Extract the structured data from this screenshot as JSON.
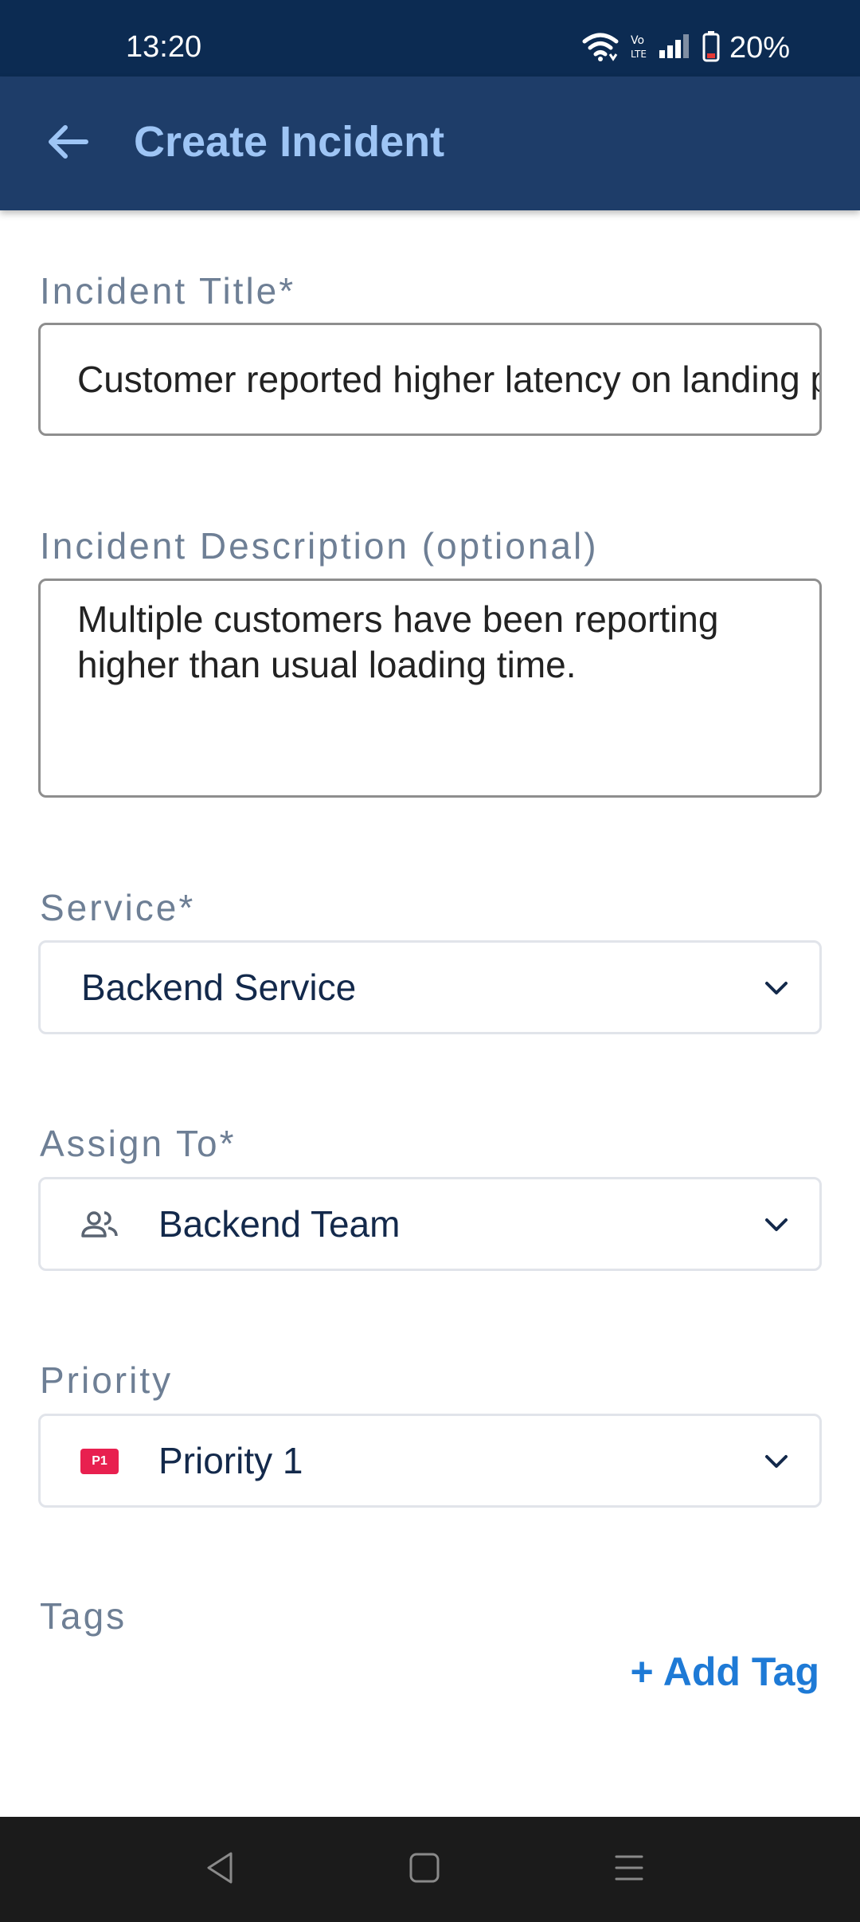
{
  "status_bar": {
    "time": "13:20",
    "battery": "20%",
    "icons": [
      "wifi-icon",
      "volte-icon",
      "signal-icon",
      "battery-icon"
    ]
  },
  "app_bar": {
    "back_icon": "arrow-left-icon",
    "title": "Create Incident"
  },
  "form": {
    "title_label": "Incident Title*",
    "title_value": "Customer reported higher latency on landing page",
    "description_label": "Incident Description (optional)",
    "description_value": "Multiple customers have been reporting higher than usual loading time.",
    "service_label": "Service*",
    "service_value": "Backend Service",
    "assign_label": "Assign To*",
    "assign_value": "Backend Team",
    "assign_icon": "people-icon",
    "priority_label": "Priority",
    "priority_badge": "P1",
    "priority_value": "Priority 1",
    "tags_label": "Tags",
    "add_tag_label": "+ Add Tag"
  },
  "nav_bar": {
    "icons": [
      "back-triangle-icon",
      "home-square-icon",
      "menu-lines-icon"
    ]
  },
  "colors": {
    "status_bar": "#0c2b52",
    "app_bar": "#1e3d69",
    "title_text": "#9ec5f5",
    "label_text": "#6e7f95",
    "value_text": "#13294b",
    "accent": "#1e7ad6",
    "priority_badge": "#e8204f",
    "nav_bar": "#1b1b1b"
  }
}
